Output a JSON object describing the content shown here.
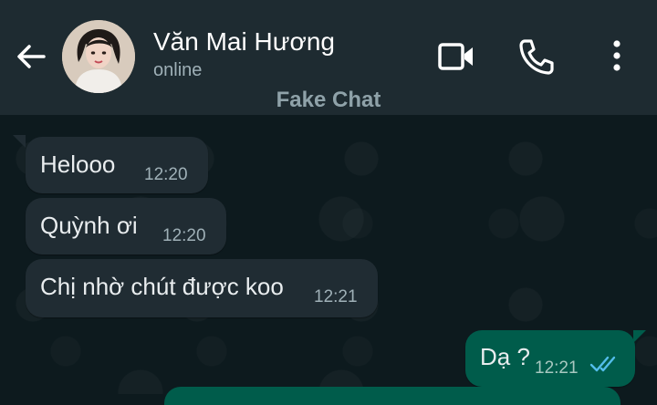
{
  "header": {
    "contact_name": "Văn Mai Hương",
    "status": "online",
    "app_title": "Fake Chat"
  },
  "messages": [
    {
      "direction": "incoming",
      "text": "Helooo",
      "time": "12:20"
    },
    {
      "direction": "incoming",
      "text": "Quỳnh ơi",
      "time": "12:20"
    },
    {
      "direction": "incoming",
      "text": "Chị nhờ chút được koo",
      "time": "12:21"
    },
    {
      "direction": "outgoing",
      "text": "Dạ ?",
      "time": "12:21",
      "read": true
    }
  ],
  "icons": {
    "back": "arrow-left-icon",
    "video": "video-camera-icon",
    "call": "phone-icon",
    "more": "more-vertical-icon",
    "read_receipt": "double-check-icon"
  },
  "colors": {
    "header_bg": "#1e2b31",
    "chat_bg": "#0d1a1e",
    "incoming_bubble": "#202c33",
    "outgoing_bubble": "#005c4b",
    "read_tick": "#53bdeb"
  }
}
